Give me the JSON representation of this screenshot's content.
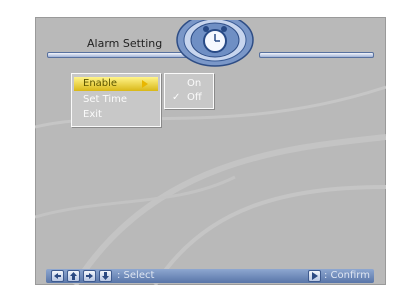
{
  "header": {
    "title": "Alarm Setting",
    "icon": "alarm-clock-icon"
  },
  "menu": {
    "items": [
      {
        "label": "Enable",
        "selected": true
      },
      {
        "label": "Set Time",
        "selected": false
      },
      {
        "label": "Exit",
        "selected": false
      }
    ]
  },
  "submenu": {
    "items": [
      {
        "label": "On",
        "checked": false
      },
      {
        "label": "Off",
        "checked": true
      }
    ],
    "check_glyph": "✓"
  },
  "footer": {
    "select_label": ": Select",
    "confirm_label": ": Confirm",
    "nav_icons": [
      "arrow-left-icon",
      "arrow-up-icon",
      "arrow-right-icon",
      "arrow-down-icon"
    ],
    "confirm_icon": "play-icon"
  },
  "colors": {
    "background": "#b9b9b9",
    "highlight": "#f3dd3c",
    "accent_blue": "#5875a8",
    "panel_text": "#fbfbfb"
  }
}
